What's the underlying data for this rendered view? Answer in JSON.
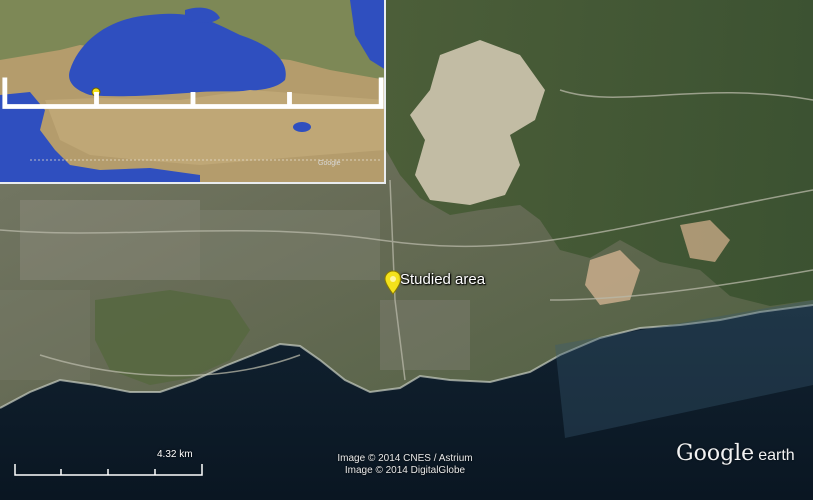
{
  "map": {
    "studied_area_label": "Studied area",
    "scale_label": "4.32 km",
    "credits": [
      "Image © 2014 CNES / Astrium",
      "Image © 2014 DigitalGlobe"
    ],
    "brand_primary": "Google",
    "brand_secondary": "earth",
    "pin_color": "#f4e21c",
    "sea_color": "#0f2233",
    "land_color": "#5d6f45"
  },
  "inset_map": {
    "brand_text": "Google",
    "water_color": "#2f4fbf",
    "land_color": "#b49c6c",
    "marker_color": "#f4e21c"
  }
}
